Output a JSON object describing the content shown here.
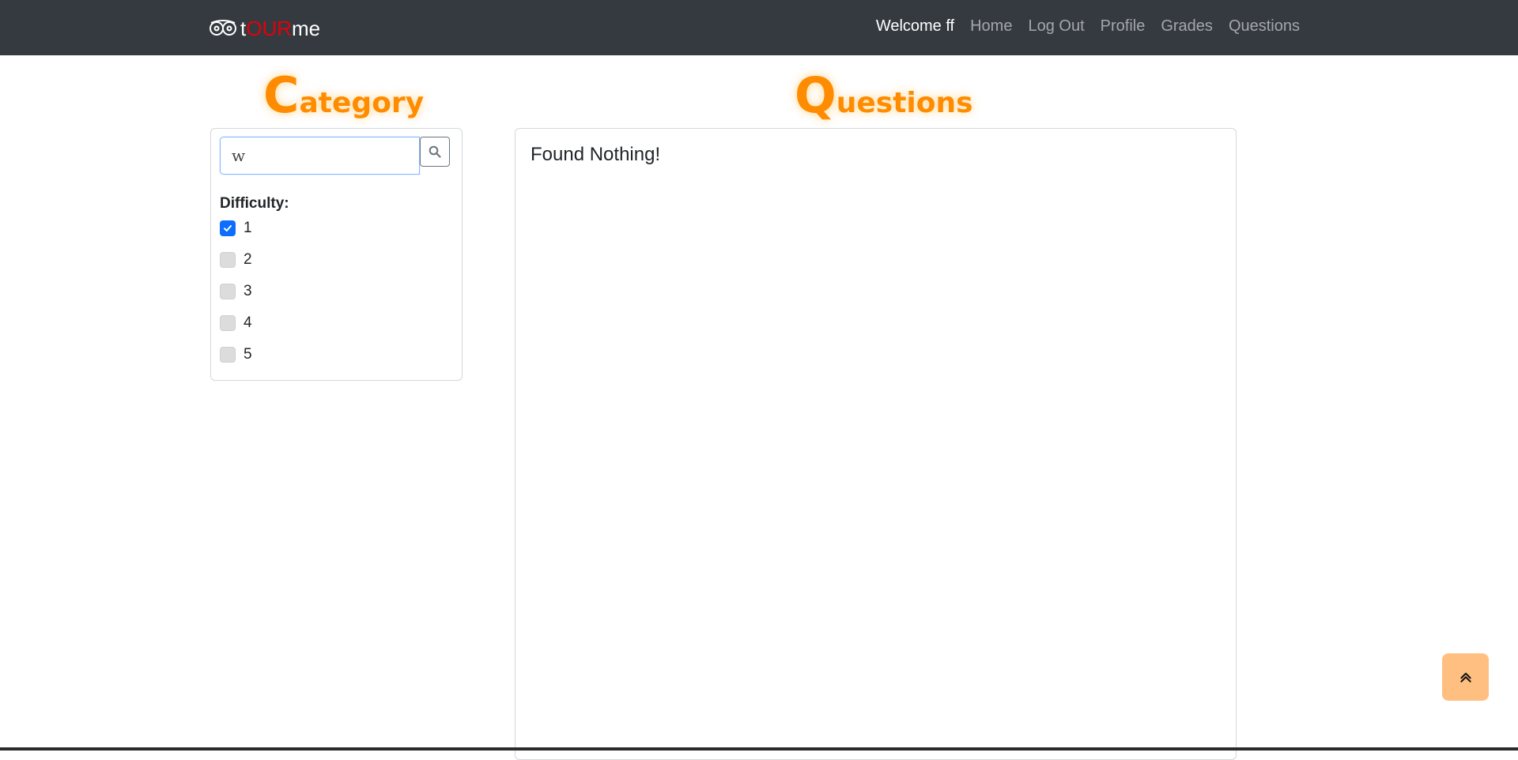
{
  "brand": {
    "prefix": "t",
    "middle": "OUR",
    "suffix": "me",
    "icon": "owl-eyes-icon",
    "accent_color": "#e3000b"
  },
  "nav": {
    "welcome": "Welcome ff",
    "links": [
      "Home",
      "Log Out",
      "Profile",
      "Grades",
      "Questions"
    ]
  },
  "category": {
    "heading_initial": "C",
    "heading_rest": "ategory",
    "search": {
      "value": "w",
      "icon": "search-icon"
    },
    "difficulty_label": "Difficulty:",
    "difficulties": [
      {
        "label": "1",
        "checked": true
      },
      {
        "label": "2",
        "checked": false
      },
      {
        "label": "3",
        "checked": false
      },
      {
        "label": "4",
        "checked": false
      },
      {
        "label": "5",
        "checked": false
      }
    ]
  },
  "questions": {
    "heading_initial": "Q",
    "heading_rest": "uestions",
    "empty_message": "Found Nothing!"
  },
  "scroll_top": {
    "icon": "double-chevron-up-icon",
    "color": "#ffbf80"
  },
  "colors": {
    "navbar": "#343a40",
    "heading": "#ff8c00",
    "checkbox_checked": "#0d6efd"
  }
}
